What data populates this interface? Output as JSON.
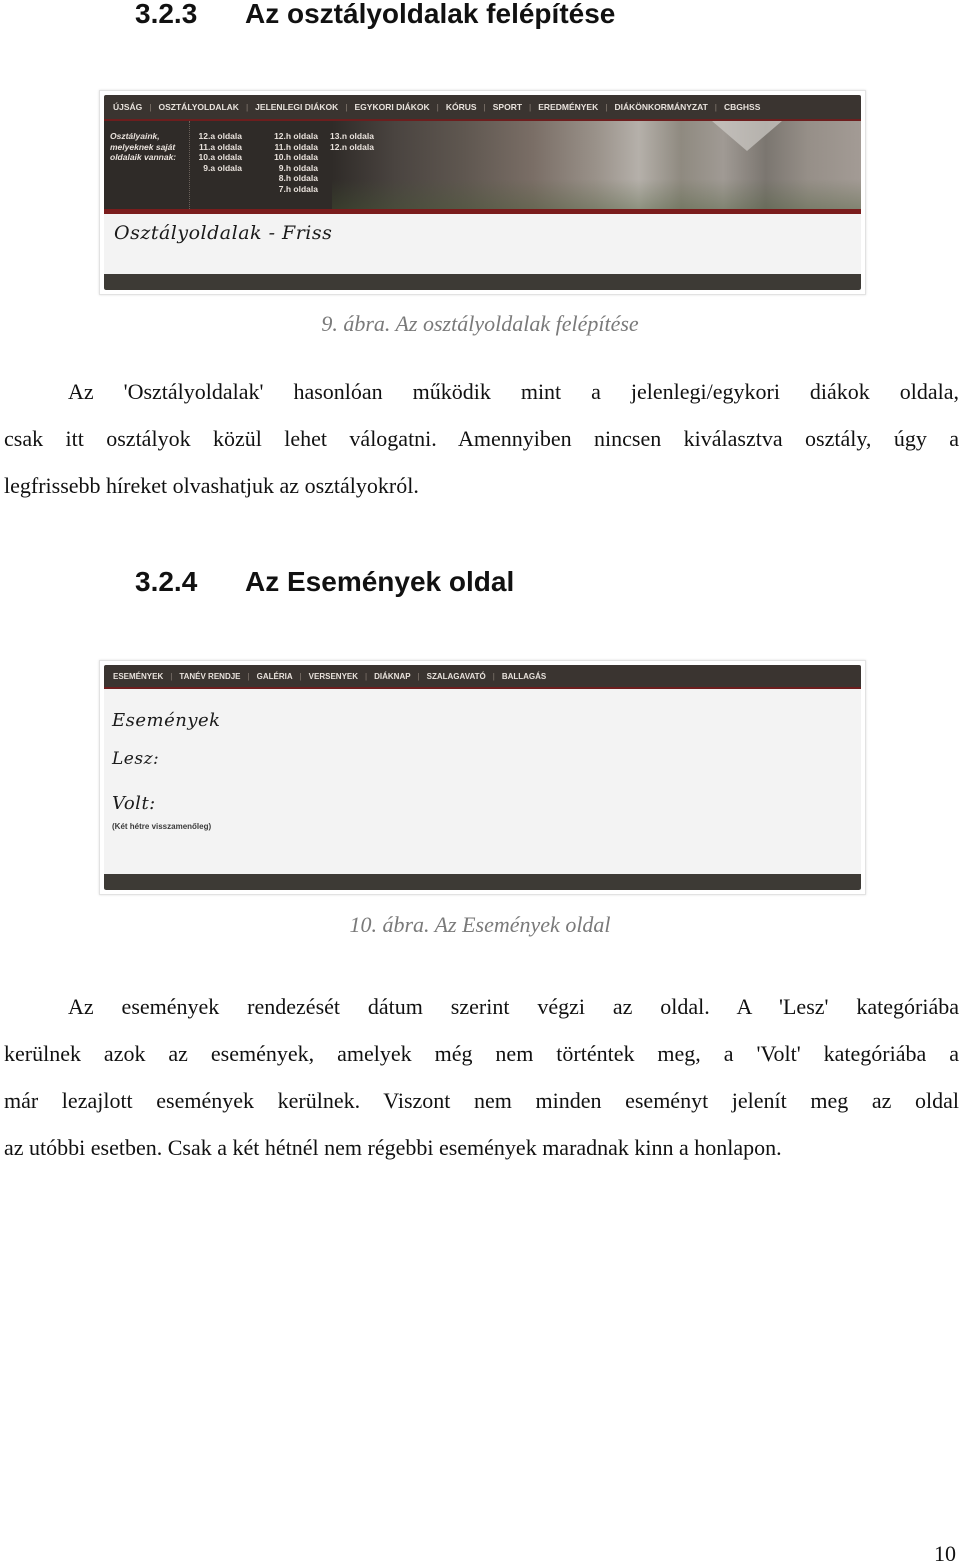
{
  "headings": {
    "section1": {
      "number": "3.2.3",
      "title": "Az osztályoldalak felépítése"
    },
    "section2": {
      "number": "3.2.4",
      "title": "Az Események oldal"
    }
  },
  "figure1": {
    "nav": [
      "ÚJSÁG",
      "OSZTÁLYOLDALAK",
      "JELENLEGI DIÁKOK",
      "EGYKORI DIÁKOK",
      "KÓRUS",
      "SPORT",
      "EREDMÉNYEK",
      "DIÁKÖNKORMÁNYZAT",
      "CBGHSS"
    ],
    "classes_label": [
      "Osztályaink,",
      "melyeknek saját",
      "oldalaik vannak:"
    ],
    "class_columns": [
      [
        "12.a oldala",
        "11.a oldala",
        "10.a oldala",
        "9.a oldala"
      ],
      [
        "12.h oldala",
        "11.h oldala",
        "10.h oldala",
        "9.h oldala",
        "8.h oldala",
        "7.h oldala"
      ],
      [
        "13.n oldala",
        "12.n oldala"
      ]
    ],
    "page_title": "Osztályoldalak - Friss",
    "caption": "9. ábra. Az osztályoldalak felépítése"
  },
  "paragraph1": [
    "Az 'Osztályoldalak' hasonlóan működik mint a jelenlegi/egykori diákok oldala,",
    "csak itt osztályok közül lehet válogatni. Amennyiben nincsen kiválasztva osztály, úgy a",
    "legfrissebb híreket olvashatjuk az osztályokról."
  ],
  "figure2": {
    "nav": [
      "ESEMÉNYEK",
      "TANÉV RENDJE",
      "GALÉRIA",
      "VERSENYEK",
      "DIÁKNAP",
      "SZALAGAVATÓ",
      "BALLAGÁS"
    ],
    "page_title": "Események",
    "lesz_label": "Lesz:",
    "volt_label": "Volt:",
    "volt_note": "(Két hétre visszamenőleg)",
    "caption": "10. ábra. Az Események oldal"
  },
  "paragraph2": [
    "Az események rendezését dátum szerint végzi az oldal. A 'Lesz' kategóriába",
    "kerülnek azok az események, amelyek még nem történtek meg, a 'Volt' kategóriába a",
    "már lezajlott események kerülnek. Viszont nem minden eseményt jelenít meg az oldal",
    "az utóbbi esetben. Csak a két hétnél nem régebbi események maradnak kinn a honlapon."
  ],
  "page_number": "10"
}
